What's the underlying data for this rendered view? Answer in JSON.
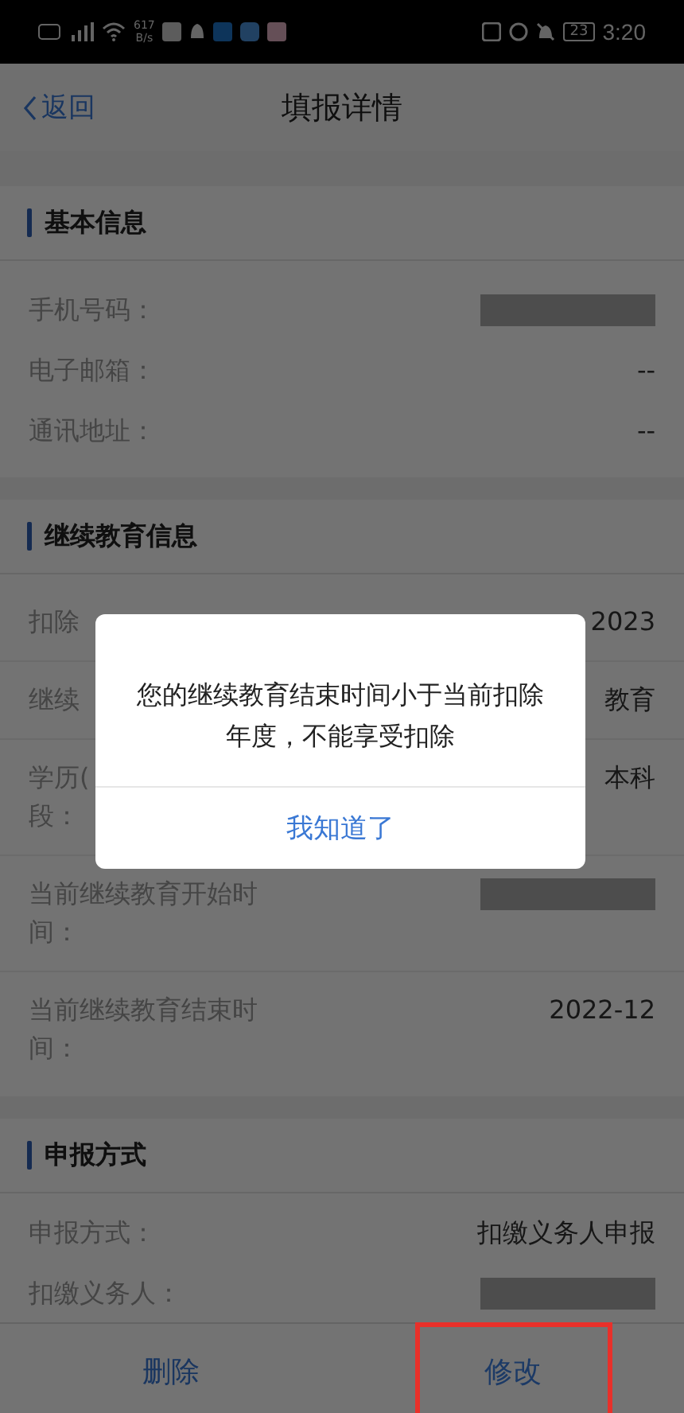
{
  "status_bar": {
    "network_speed": "617",
    "speed_unit": "B/s",
    "battery": "23",
    "time": "3:20"
  },
  "nav": {
    "back": "返回",
    "title": "填报详情"
  },
  "sections": [
    {
      "title": "基本信息",
      "rows": [
        {
          "label_lines": [
            "手机号码："
          ],
          "kind": "redacted"
        },
        {
          "label_lines": [
            "电子邮箱："
          ],
          "kind": "text",
          "value": "--"
        },
        {
          "label_lines": [
            "通讯地址："
          ],
          "kind": "text",
          "value": "--"
        }
      ]
    },
    {
      "title": "继续教育信息",
      "rows": [
        {
          "label_lines": [
            "扣除"
          ],
          "kind": "text",
          "value": "2023"
        },
        {
          "label_lines": [
            "继续"
          ],
          "kind": "text",
          "value": "教育"
        },
        {
          "label_lines": [
            "学历(",
            "段："
          ],
          "kind": "text",
          "value": "本科"
        },
        {
          "label_lines": [
            "当前继续教育开始时",
            "间："
          ],
          "kind": "redacted"
        },
        {
          "label_lines": [
            "当前继续教育结束时",
            "间："
          ],
          "kind": "text",
          "value": "2022-12"
        }
      ]
    },
    {
      "title": "申报方式",
      "rows": [
        {
          "label_lines": [
            "申报方式："
          ],
          "kind": "text",
          "value": "扣缴义务人申报"
        },
        {
          "label_lines": [
            "扣缴义务人："
          ],
          "kind": "redacted"
        }
      ]
    }
  ],
  "actions": [
    {
      "label": "删除",
      "highlighted": false
    },
    {
      "label": "修改",
      "highlighted": true
    }
  ],
  "dialog": {
    "message": "您的继续教育结束时间小于当前扣除年度，不能享受扣除",
    "button": "我知道了"
  }
}
